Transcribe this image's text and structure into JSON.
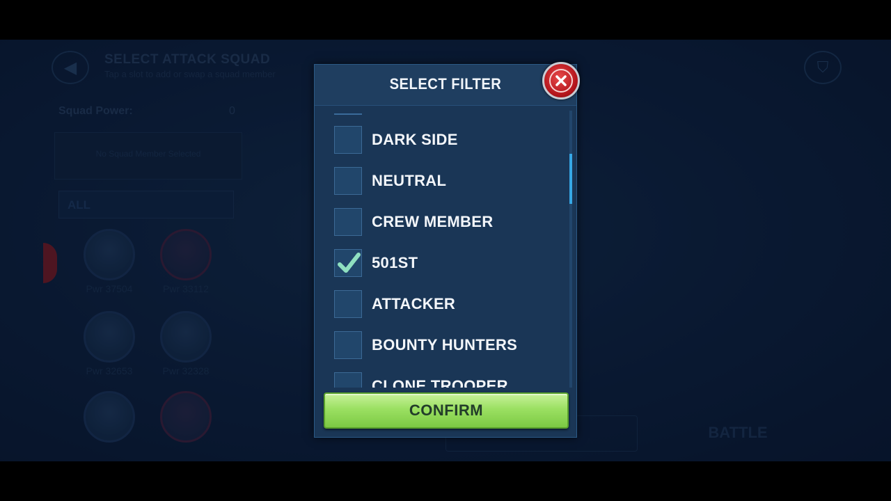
{
  "background": {
    "title": "SELECT ATTACK SQUAD",
    "subtitle": "Tap a slot to add or swap a squad member",
    "squad_power_label": "Squad Power:",
    "squad_power_value": "0",
    "slot_text": "No Squad Member Selected",
    "filter_select_value": "ALL",
    "characters": [
      {
        "pwr": "Pwr 37504"
      },
      {
        "pwr": "Pwr 33112"
      },
      {
        "pwr": "Pwr 32653"
      },
      {
        "pwr": "Pwr 32328"
      },
      {
        "pwr": ""
      },
      {
        "pwr": ""
      }
    ],
    "battle_label": "BATTLE"
  },
  "modal": {
    "title": "SELECT FILTER",
    "filters": [
      {
        "label": "DARK SIDE",
        "checked": false
      },
      {
        "label": "NEUTRAL",
        "checked": false
      },
      {
        "label": "CREW MEMBER",
        "checked": false
      },
      {
        "label": "501ST",
        "checked": true
      },
      {
        "label": "ATTACKER",
        "checked": false
      },
      {
        "label": "BOUNTY HUNTERS",
        "checked": false
      },
      {
        "label": "CLONE TROOPER",
        "checked": false
      }
    ],
    "confirm_label": "CONFIRM",
    "check_color": "#8fe0c0"
  }
}
